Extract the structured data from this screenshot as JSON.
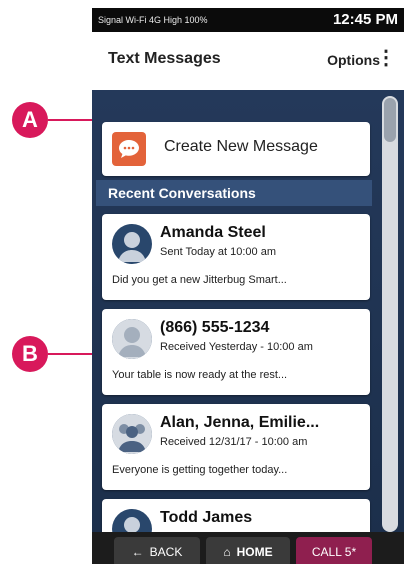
{
  "status_bar": {
    "left_text": "Signal  Wi-Fi  4G  High  100%",
    "time": "12:45 PM"
  },
  "header": {
    "title": "Text Messages",
    "options_label": "Options"
  },
  "new_message": {
    "label": "Create New Message"
  },
  "recent": {
    "heading": "Recent Conversations",
    "items": [
      {
        "name": "Amanda Steel",
        "meta": "Sent Today at 10:00 am",
        "preview": "Did you get a new Jitterbug Smart..."
      },
      {
        "name": "(866) 555-1234",
        "meta": "Received Yesterday - 10:00 am",
        "preview": "Your table is now ready at the rest..."
      },
      {
        "name": "Alan, Jenna, Emilie...",
        "meta": "Received 12/31/17 - 10:00 am",
        "preview": "Everyone is getting together today..."
      },
      {
        "name": "Todd James",
        "meta": "",
        "preview": ""
      }
    ]
  },
  "bottom": {
    "back_label": "BACK",
    "home_label": "HOME",
    "call_label": "CALL 5*"
  },
  "callouts": {
    "a": "A",
    "b": "B"
  },
  "colors": {
    "accent": "#d8195b",
    "message_icon": "#e3633a",
    "background": "#1f3350"
  },
  "icons": {
    "message": "message-bubble-icon",
    "back": "arrow-left-icon",
    "home": "home-icon",
    "menu": "kebab-menu-icon",
    "avatar": "person-silhouette-icon"
  }
}
